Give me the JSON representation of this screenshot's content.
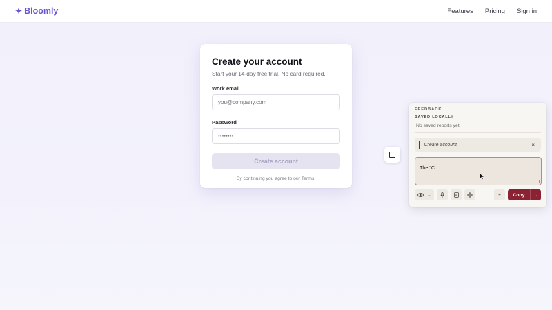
{
  "header": {
    "brand_icon": "✦",
    "brand_name": "Bloomly",
    "brand_color": "#6b55d6",
    "nav": [
      {
        "label": "Features"
      },
      {
        "label": "Pricing"
      },
      {
        "label": "Sign in"
      }
    ]
  },
  "signup": {
    "title": "Create your account",
    "subtitle": "Start your 14-day free trial. No card required.",
    "email_label": "Work email",
    "email_placeholder": "you@company.com",
    "password_label": "Password",
    "password_value": "••••••••",
    "submit_label": "Create account",
    "terms": "By continuing you agree to our Terms."
  },
  "feedback_panel": {
    "heading": "FEEDBACK",
    "saved_heading": "SAVED LOCALLY",
    "empty_text": "No saved reports yet.",
    "target_label": "Create account",
    "close_glyph": "×",
    "note_text": "The \"C",
    "tools": {
      "eye_icon": "eye-icon",
      "chevron_glyph": "⌄",
      "mic_icon": "microphone-icon",
      "doc_icon": "document-icon",
      "crosshair_icon": "crosshair-icon",
      "plus_glyph": "+"
    },
    "copy_label": "Copy",
    "copy_dropdown_glyph": "⌄",
    "accent_color": "#8b2233"
  }
}
